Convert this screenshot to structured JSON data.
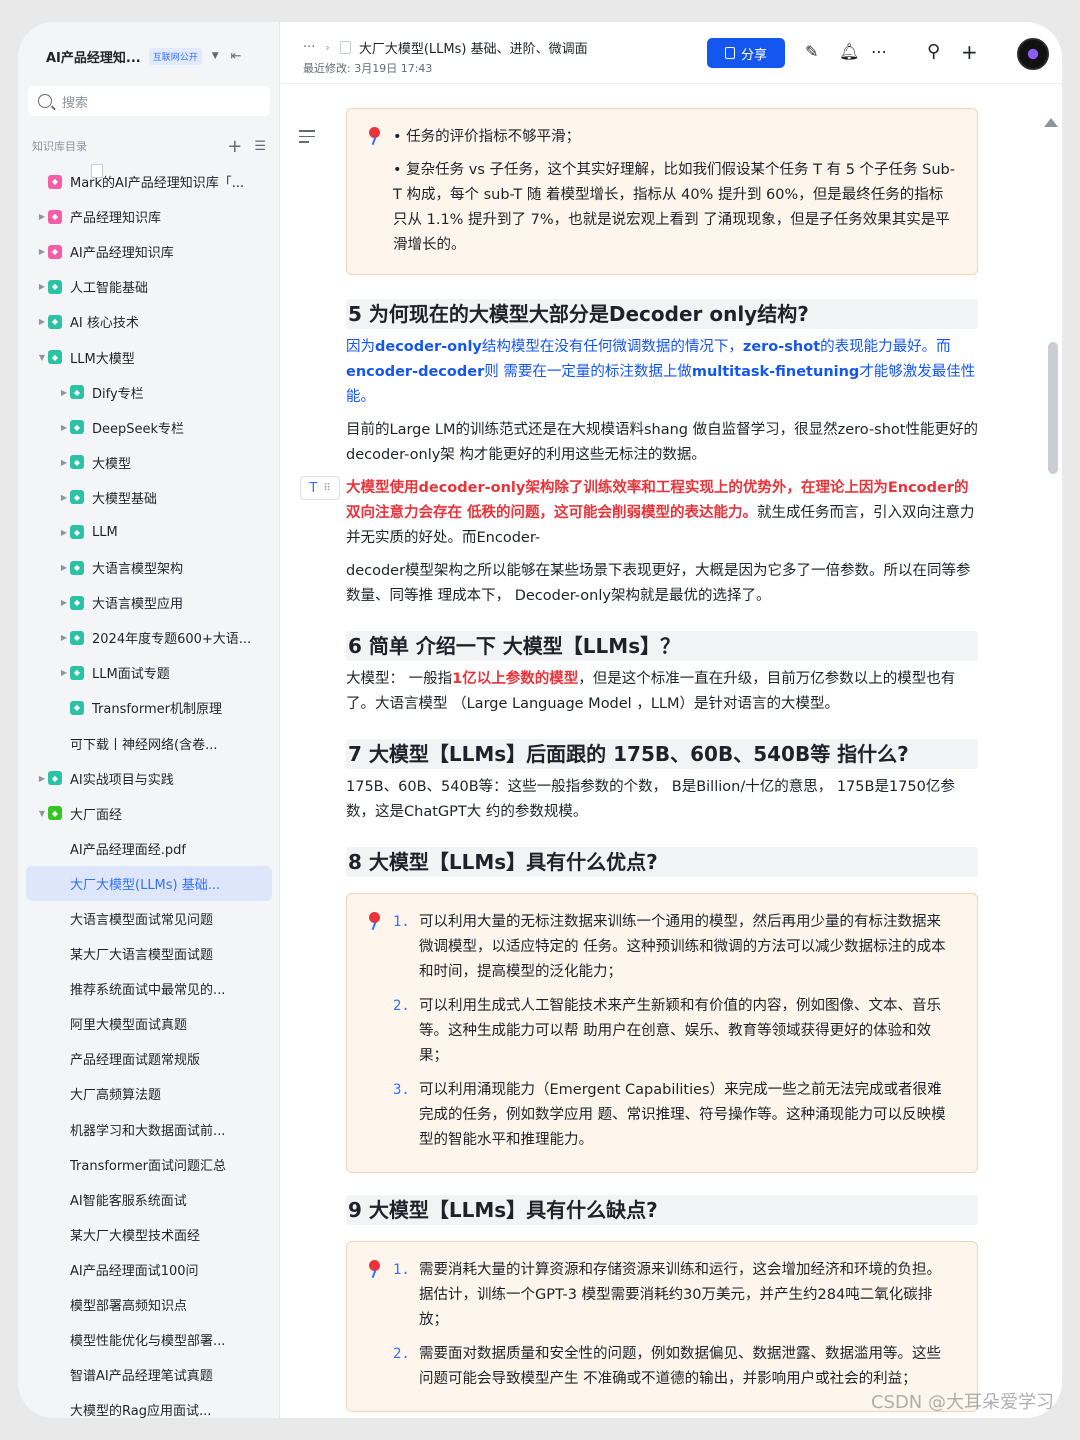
{
  "sidebar": {
    "title": "AI产品经理知...",
    "badge": "互联网公开",
    "search_placeholder": "搜索",
    "directory_label": "知识库目录",
    "items": [
      {
        "label": "Mark的AI产品经理知识库「...",
        "icon": "pink",
        "arrow": ""
      },
      {
        "label": "产品经理知识库",
        "icon": "pink",
        "arrow": "▶"
      },
      {
        "label": "AI产品经理知识库",
        "icon": "pink",
        "arrow": "▶"
      },
      {
        "label": "人工智能基础",
        "icon": "teal",
        "arrow": "▶"
      },
      {
        "label": "AI 核心技术",
        "icon": "teal",
        "arrow": "▶"
      },
      {
        "label": "LLM大模型",
        "icon": "teal",
        "arrow": "▼"
      },
      {
        "label": "Dify专栏",
        "icon": "teal",
        "arrow": "▶",
        "indent": 1
      },
      {
        "label": "DeepSeek专栏",
        "icon": "teal",
        "arrow": "▶",
        "indent": 1
      },
      {
        "label": "大模型",
        "icon": "teal",
        "arrow": "▶",
        "indent": 1
      },
      {
        "label": "大模型基础",
        "icon": "teal",
        "arrow": "▶",
        "indent": 1
      },
      {
        "label": "LLM",
        "icon": "teal",
        "arrow": "▶",
        "indent": 1
      },
      {
        "label": "大语言模型架构",
        "icon": "teal",
        "arrow": "▶",
        "indent": 1
      },
      {
        "label": "大语言模型应用",
        "icon": "teal",
        "arrow": "▶",
        "indent": 1
      },
      {
        "label": "2024年度专题600+大语...",
        "icon": "teal",
        "arrow": "▶",
        "indent": 1
      },
      {
        "label": "LLM面试专题",
        "icon": "teal",
        "arrow": "▶",
        "indent": 1
      },
      {
        "label": "Transformer机制原理",
        "icon": "teal",
        "arrow": "",
        "indent": 1
      },
      {
        "label": "可下载丨神经网络(含卷...",
        "icon": "doc",
        "arrow": "",
        "indent": 1
      },
      {
        "label": "AI实战项目与实践",
        "icon": "teal",
        "arrow": "▶"
      },
      {
        "label": "大厂面经",
        "icon": "green",
        "arrow": "▼"
      },
      {
        "label": "AI产品经理面经.pdf",
        "icon": "doc",
        "arrow": "",
        "indent": 1
      },
      {
        "label": "大厂大模型(LLMs) 基础...",
        "icon": "doc",
        "arrow": "",
        "indent": 1,
        "selected": true
      },
      {
        "label": "大语言模型面试常见问题",
        "icon": "doc",
        "arrow": "",
        "indent": 1
      },
      {
        "label": "某大厂大语言模型面试题",
        "icon": "doc",
        "arrow": "",
        "indent": 1
      },
      {
        "label": "推荐系统面试中最常见的...",
        "icon": "doc",
        "arrow": "",
        "indent": 1
      },
      {
        "label": "阿里大模型面试真题",
        "icon": "doc",
        "arrow": "",
        "indent": 1
      },
      {
        "label": "产品经理面试题常规版",
        "icon": "doc",
        "arrow": "",
        "indent": 1
      },
      {
        "label": "大厂高频算法题",
        "icon": "doc",
        "arrow": "",
        "indent": 1
      },
      {
        "label": "机器学习和大数据面试前...",
        "icon": "doc",
        "arrow": "",
        "indent": 1
      },
      {
        "label": "Transformer面试问题汇总",
        "icon": "doc",
        "arrow": "",
        "indent": 1
      },
      {
        "label": "AI智能客服系统面试",
        "icon": "doc",
        "arrow": "",
        "indent": 1
      },
      {
        "label": "某大厂大模型技术面经",
        "icon": "doc",
        "arrow": "",
        "indent": 1
      },
      {
        "label": "AI产品经理面试100问",
        "icon": "doc",
        "arrow": "",
        "indent": 1
      },
      {
        "label": "模型部署高频知识点",
        "icon": "doc",
        "arrow": "",
        "indent": 1
      },
      {
        "label": "模型性能优化与模型部署...",
        "icon": "doc",
        "arrow": "",
        "indent": 1
      },
      {
        "label": "智谱AI产品经理笔试真题",
        "icon": "doc",
        "arrow": "",
        "indent": 1
      },
      {
        "label": "大模型的Rag应用面试...",
        "icon": "doc",
        "arrow": "",
        "indent": 1
      }
    ]
  },
  "topbar": {
    "dots": "···",
    "doc_title": "大厂大模型(LLMs) 基础、进阶、微调面",
    "last_modified": "最近修改: 3月19日 17:43",
    "share_label": "分享"
  },
  "doc": {
    "callout1": {
      "b1": "任务的评价指标不够平滑；",
      "b2": "复杂任务 vs 子任务，这个其实好理解，比如我们假设某个任务 T 有 5 个子任务 Sub-T 构成，每个 sub-T 随 着模型增长，指标从 40% 提升到 60%，但是最终任务的指标只从 1.1% 提升到了 7%，也就是说宏观上看到 了涌现现象，但是子任务效果其实是平滑增长的。"
    },
    "h5": "5 为何现在的大模型大部分是Decoder only结构?",
    "p5a": {
      "t1": "因为",
      "t2": "decoder-only",
      "t3": "结构模型在没有任何微调数据的情况下，",
      "t4": "zero-shot",
      "t5": "的表现能力最好。而",
      "t6": "encoder-decoder",
      "t7": "则 需要在一定量的标注数据上做",
      "t8": "multitask-finetuning",
      "t9": "才能够激发最佳性能。"
    },
    "p5b": "目前的Large LM的训练范式还是在大规模语料shang 做自监督学习，很显然zero-shot性能更好的decoder-only架 构才能更好的利用这些无标注的数据。",
    "p5c": {
      "t1": "大模型使用decoder-only架构除了训练效率和工程实现上的优势外，在理论上因为Encoder的双向注意力会存在 低秩的问题，这可能会削弱模型的表达能力。",
      "t2": "就生成任务而言，引入双向注意力并无实质的好处。而Encoder-"
    },
    "p5d": "decoder模型架构之所以能够在某些场景下表现更好，大概是因为它多了一倍参数。所以在同等参数量、同等推 理成本下， Decoder-only架构就是最优的选择了。",
    "h6": "6 简单 介绍一下 大模型【LLMs】？",
    "p6": {
      "t1": "大模型： 一般指",
      "t2": "1亿以上参数的模型",
      "t3": "，但是这个标准一直在升级，目前万亿参数以上的模型也有了。大语言模型 （Large Language Model ，LLM）是针对语言的大模型。"
    },
    "h7": "7 大模型【LLMs】后面跟的 175B、60B、540B等 指什么?",
    "p7": "175B、60B、540B等：这些一般指参数的个数， B是Billion/十亿的意思， 175B是1750亿参数，这是ChatGPT大 约的参数规模。",
    "h8": "8 大模型【LLMs】具有什么优点?",
    "ol8": [
      {
        "n": "1.",
        "t": "可以利用大量的无标注数据来训练一个通用的模型，然后再用少量的有标注数据来微调模型，以适应特定的 任务。这种预训练和微调的方法可以减少数据标注的成本和时间，提高模型的泛化能力；"
      },
      {
        "n": "2.",
        "t": "可以利用生成式人工智能技术来产生新颖和有价值的内容，例如图像、文本、音乐等。这种生成能力可以帮 助用户在创意、娱乐、教育等领域获得更好的体验和效果；"
      },
      {
        "n": "3.",
        "t": "可以利用涌现能力（Emergent Capabilities）来完成一些之前无法完成或者很难完成的任务，例如数学应用 题、常识推理、符号操作等。这种涌现能力可以反映模型的智能水平和推理能力。"
      }
    ],
    "h9": "9 大模型【LLMs】具有什么缺点?",
    "ol9": [
      {
        "n": "1.",
        "t": "需要消耗大量的计算资源和存储资源来训练和运行，这会增加经济和环境的负担。据估计，训练一个GPT-3 模型需要消耗约30万美元，并产生约284吨二氧化碳排放；"
      },
      {
        "n": "2.",
        "t": "需要面对数据质量和安全性的问题，例如数据偏见、数据泄露、数据滥用等。这些问题可能会导致模型产生 不准确或不道德的输出，并影响用户或社会的利益；"
      }
    ]
  },
  "watermark": "CSDN @大耳朵爱学习"
}
